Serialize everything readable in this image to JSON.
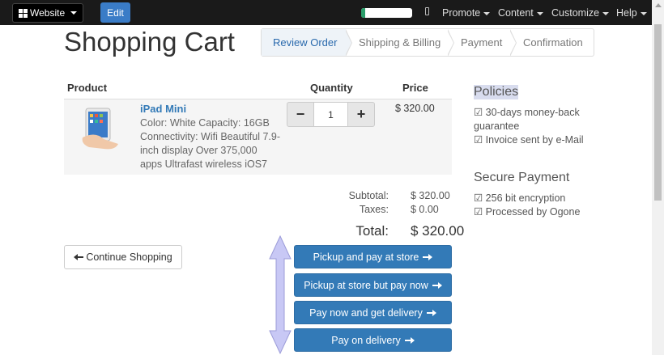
{
  "topbar": {
    "website_label": "Website",
    "edit_label": "Edit",
    "progress_fraction": 0.08,
    "menus": [
      "Promote",
      "Content",
      "Customize",
      "Help"
    ]
  },
  "page": {
    "title": "Shopping Cart"
  },
  "wizard": {
    "steps": [
      "Review Order",
      "Shipping & Billing",
      "Payment",
      "Confirmation"
    ],
    "active_step": "Review Order"
  },
  "cart_table": {
    "headers": {
      "product": "Product",
      "quantity": "Quantity",
      "price": "Price"
    },
    "rows": [
      {
        "name": "iPad Mini",
        "description": "Color: White Capacity: 16GB Connectivity: Wifi Beautiful 7.9-inch display Over 375,000 apps Ultrafast wireless iOS7",
        "quantity": "1",
        "minus": "−",
        "plus": "+",
        "price": "$ 320.00"
      }
    ]
  },
  "totals": {
    "subtotal_label": "Subtotal:",
    "subtotal_value": "$ 320.00",
    "taxes_label": "Taxes:",
    "taxes_value": "$ 0.00",
    "total_label": "Total:",
    "total_value": "$ 320.00"
  },
  "actions": {
    "continue_label": "Continue Shopping",
    "pay_buttons": [
      "Pickup and pay at store",
      "Pickup at store but pay now",
      "Pay now and get delivery",
      "Pay on delivery"
    ]
  },
  "sidebar": {
    "policies_title": "Policies",
    "policies": [
      "☑ 30-days money-back guarantee",
      "☑ Invoice sent by e-Mail"
    ],
    "secure_title": "Secure Payment",
    "secure": [
      "☑ 256 bit encryption",
      "☑ Processed by Ogone"
    ]
  },
  "colors": {
    "primary": "#337ab7",
    "topbar": "#1a1a1a",
    "drag_arrow": "#c8c8f5"
  }
}
